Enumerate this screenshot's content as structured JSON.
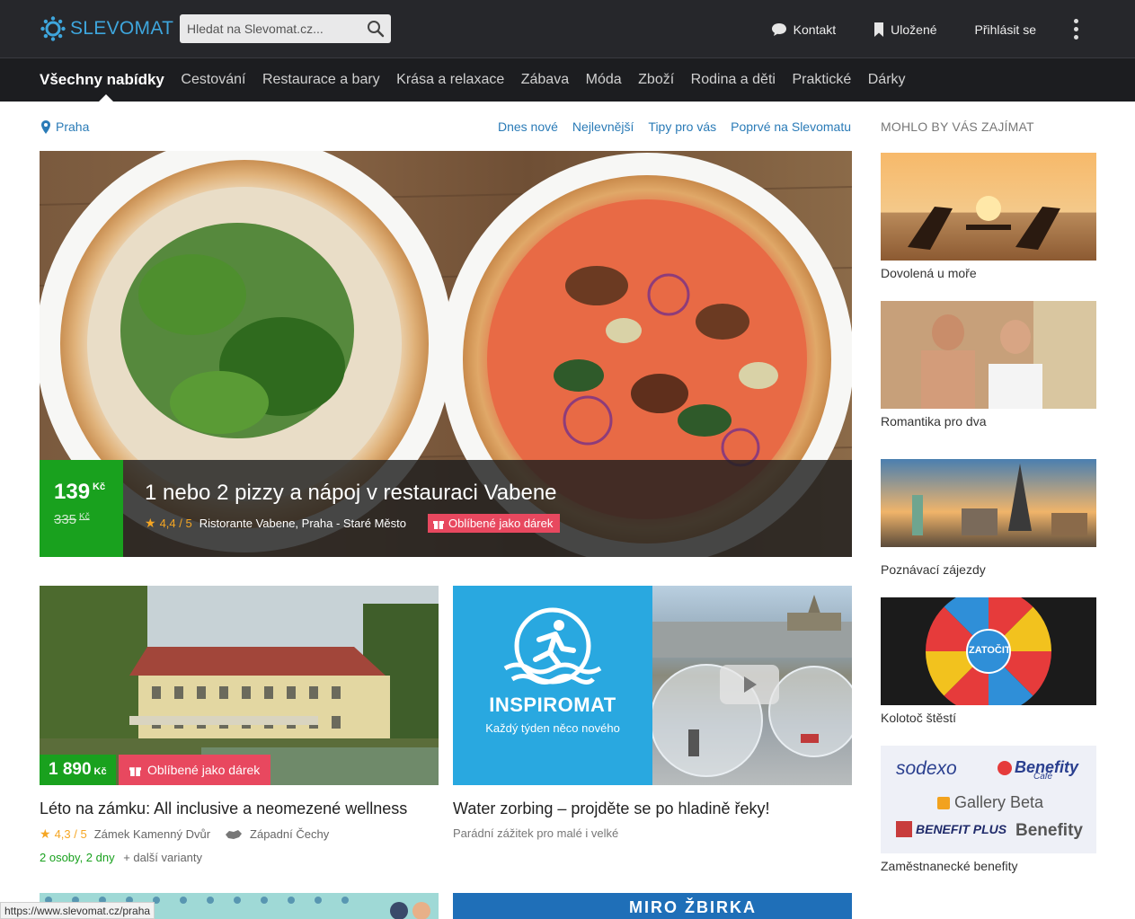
{
  "header": {
    "logo_text": "SLEVOMAT",
    "search": {
      "placeholder": "Hledat na Slevomat.cz..."
    },
    "links": {
      "contact": "Kontakt",
      "saved": "Uložené",
      "login": "Přihlásit se"
    }
  },
  "nav": {
    "items": [
      "Všechny nabídky",
      "Cestování",
      "Restaurace a bary",
      "Krása a relaxace",
      "Zábava",
      "Móda",
      "Zboží",
      "Rodina a děti",
      "Praktické",
      "Dárky"
    ],
    "active": "Všechny nabídky"
  },
  "filter": {
    "location": "Praha",
    "tabs": [
      "Dnes nové",
      "Nejlevnější",
      "Tipy pro vás",
      "Poprvé na Slevomatu"
    ]
  },
  "hero": {
    "price": "139",
    "price_currency": "Kč",
    "old_price": "335",
    "old_currency": "Kč",
    "title": "1 nebo 2 pizzy a nápoj v restauraci Vabene",
    "rating": "4,4 / 5",
    "place": "Ristorante Vabene, Praha - Staré Město",
    "gift": "Oblíbené jako dárek"
  },
  "cards": [
    {
      "price": "1 890",
      "currency": "Kč",
      "gift": "Oblíbené jako dárek",
      "title": "Léto na zámku: All inclusive a neomezené wellness",
      "rating": "4,3 / 5",
      "place": "Zámek Kamenný Dvůr",
      "region": "Západní Čechy",
      "variant": "2 osoby, 2 dny",
      "more": "+  další varianty"
    },
    {
      "brand": "INSPIROMAT",
      "brand_sub": "Každý týden něco nového",
      "title": "Water zorbing – projděte se po hladině řeky!",
      "subtitle": "Parádní zážitek pro malé i velké"
    }
  ],
  "bottom_banner_text": "MIRO ŽBIRKA",
  "sidebar": {
    "heading": "MOHLO BY VÁS ZAJÍMAT",
    "items": [
      {
        "label": "Dovolená u moře"
      },
      {
        "label": "Romantika pro dva"
      },
      {
        "label": "Poznávací zájezdy"
      },
      {
        "label": "Kolotoč štěstí",
        "wheel_text": "ZATOČIT"
      },
      {
        "label": "Zaměstnanecké benefity",
        "logos": [
          "sodexo",
          "Benefity",
          "Café",
          "Gallery Beta",
          "BENEFIT PLUS",
          "Benefity"
        ]
      }
    ]
  },
  "status_url": "https://www.slevomat.cz/praha",
  "colors": {
    "header_bg": "#26272b",
    "nav_bg": "#1c1d20",
    "accent_blue": "#2a7bb7",
    "price_green": "#19a11e",
    "gift_pink": "#e8485f"
  }
}
